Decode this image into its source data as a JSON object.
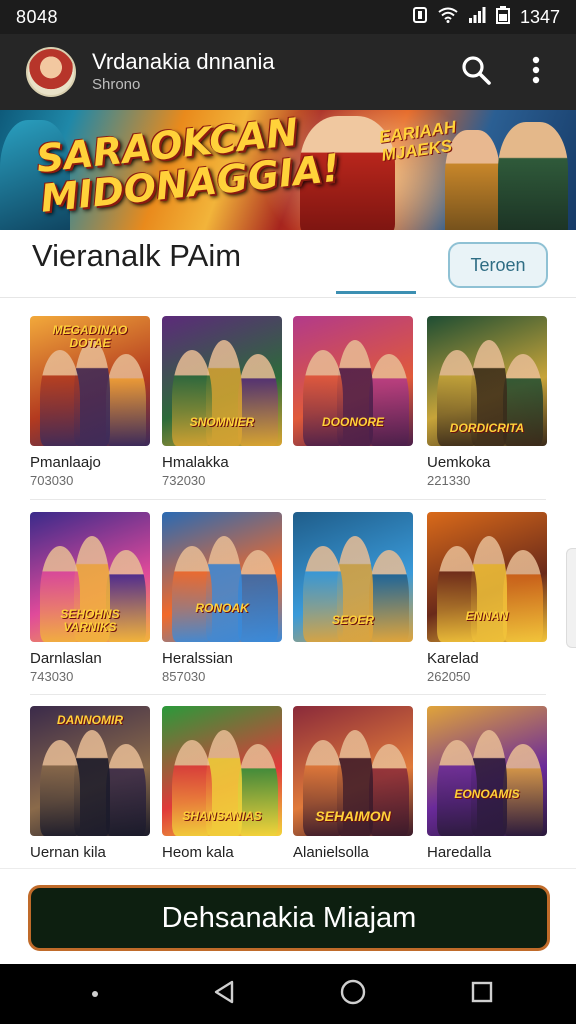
{
  "status_bar": {
    "time": "8048",
    "right_time": "1347",
    "icons": [
      "notification-icon",
      "wifi-icon",
      "signal-icon",
      "battery-icon"
    ]
  },
  "app_bar": {
    "title": "Vrdanakia dnnania",
    "subtitle": "Shrono",
    "actions": [
      "search-icon",
      "more-vert-icon"
    ]
  },
  "banner": {
    "headline": "SARAOKCAN MIDONAGGIA!",
    "tag": "EARIAAH MJAEKS"
  },
  "section": {
    "title": "Vieranalk PAim",
    "button_label": "Teroen"
  },
  "games": [
    {
      "name": "Pmanlaajo",
      "count": "703030",
      "art": "MEGADINAO DOTAE",
      "colors": [
        "#f2a93b",
        "#b33a1f",
        "#3b2a5a"
      ]
    },
    {
      "name": "Hmalakka",
      "count": "732030",
      "art": "SNOMNIER",
      "colors": [
        "#5c2a7a",
        "#2d6b3a",
        "#d9a431"
      ]
    },
    {
      "name": "",
      "count": "",
      "art": "DOONORE",
      "colors": [
        "#b23a8a",
        "#e05a3a",
        "#4a1f4a"
      ]
    },
    {
      "name": "Uemkoka",
      "count": "221330",
      "art": "DORDICRITA",
      "colors": [
        "#1e4d33",
        "#c7a43a",
        "#3a2a1a"
      ]
    },
    {
      "name": "Darnlaslan",
      "count": "743030",
      "art": "SEHOHNS VARNIKS",
      "colors": [
        "#3a2a8a",
        "#e04a9a",
        "#f2b43a"
      ]
    },
    {
      "name": "Heralssian",
      "count": "857030",
      "art": "RONOAK",
      "colors": [
        "#2a6ab3",
        "#f26a2a",
        "#3a8ad9"
      ]
    },
    {
      "name": "",
      "count": "",
      "art": "SEOER",
      "colors": [
        "#1f5d8a",
        "#3a9ad9",
        "#e0a43a"
      ]
    },
    {
      "name": "Karelad",
      "count": "262050",
      "art": "ENNAN",
      "colors": [
        "#d96a1a",
        "#6a2a1a",
        "#f2c43a"
      ]
    },
    {
      "name": "Uernan kila",
      "count": "",
      "art": "DANNOMIR",
      "colors": [
        "#3a2a4a",
        "#8a6a4a",
        "#1a1a2a"
      ]
    },
    {
      "name": "Heom kala",
      "count": "",
      "art": "SHANSANIAS",
      "colors": [
        "#2a9a3a",
        "#e03a3a",
        "#f2d43a"
      ]
    },
    {
      "name": "Alanielsolla",
      "count": "",
      "art": "SEHAIMON",
      "colors": [
        "#8a2a3a",
        "#e07a3a",
        "#3a1a2a"
      ]
    },
    {
      "name": "Haredalla",
      "count": "",
      "art": "EONOAMIS",
      "colors": [
        "#e0a43a",
        "#6a2a9a",
        "#2a1a3a"
      ]
    }
  ],
  "cta": {
    "label": "Dehsanakia Miajam"
  },
  "nav_bar": {
    "buttons": [
      "menu-dot-icon",
      "back-icon",
      "home-icon",
      "recents-icon"
    ]
  }
}
